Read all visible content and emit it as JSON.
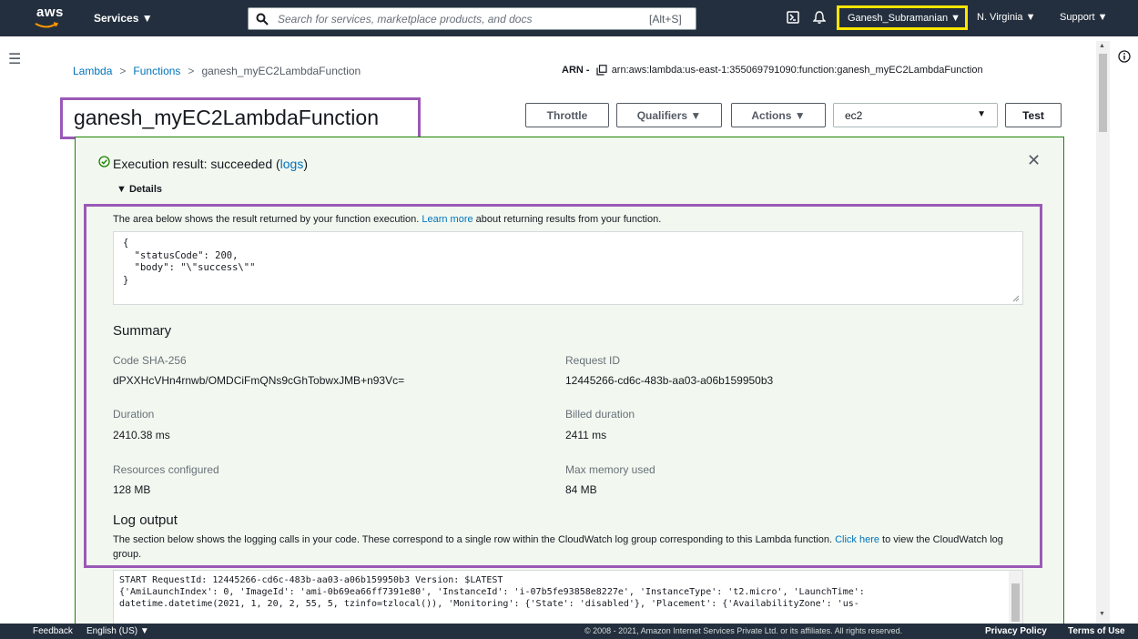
{
  "nav": {
    "logo_text": "aws",
    "services": "Services ▼",
    "search_placeholder": "Search for services, marketplace products, and docs",
    "search_shortcut": "[Alt+S]",
    "user": "Ganesh_Subramanian ▼",
    "region": "N. Virginia ▼",
    "support": "Support ▼"
  },
  "breadcrumb": {
    "items": [
      "Lambda",
      "Functions",
      "ganesh_myEC2LambdaFunction"
    ],
    "separator": ">"
  },
  "arn": {
    "label": "ARN -",
    "value": "arn:aws:lambda:us-east-1:355069791090:function:ganesh_myEC2LambdaFunction"
  },
  "title": "ganesh_myEC2LambdaFunction",
  "toolbar": {
    "throttle": "Throttle",
    "qualifiers": "Qualifiers ▼",
    "actions": "Actions ▼",
    "test_event": "ec2",
    "test": "Test"
  },
  "execution": {
    "title": "Execution result: succeeded (",
    "logs_link": "logs",
    "title_end": ")",
    "details": "▼ Details",
    "intro_before": "The area below shows the result returned by your function execution. ",
    "intro_link": "Learn more",
    "intro_after": " about returning results from your function.",
    "result_json": "{\n  \"statusCode\": 200,\n  \"body\": \"\\\"success\\\"\"\n}"
  },
  "summary": {
    "heading": "Summary",
    "code_sha_label": "Code SHA-256",
    "code_sha_value": "dPXXHcVHn4rnwb/OMDCiFmQNs9cGhTobwxJMB+n93Vc=",
    "request_id_label": "Request ID",
    "request_id_value": "12445266-cd6c-483b-aa03-a06b159950b3",
    "duration_label": "Duration",
    "duration_value": "2410.38 ms",
    "billed_label": "Billed duration",
    "billed_value": "2411 ms",
    "resources_label": "Resources configured",
    "resources_value": "128 MB",
    "memory_label": "Max memory used",
    "memory_value": "84 MB"
  },
  "log": {
    "heading": "Log output",
    "desc_before": "The section below shows the logging calls in your code. These correspond to a single row within the CloudWatch log group corresponding to this Lambda function. ",
    "desc_link": "Click here",
    "desc_after": " to view the CloudWatch log group.",
    "text": "START RequestId: 12445266-cd6c-483b-aa03-a06b159950b3 Version: $LATEST\n{'AmiLaunchIndex': 0, 'ImageId': 'ami-0b69ea66ff7391e80', 'InstanceId': 'i-07b5fe93858e8227e', 'InstanceType': 't2.micro', 'LaunchTime':\ndatetime.datetime(2021, 1, 20, 2, 55, 5, tzinfo=tzlocal()), 'Monitoring': {'State': 'disabled'}, 'Placement': {'AvailabilityZone': 'us-"
  },
  "footer": {
    "feedback": "Feedback",
    "language": "English (US) ▼",
    "copyright": "© 2008 - 2021, Amazon Internet Services Private Ltd. or its affiliates. All rights reserved.",
    "privacy": "Privacy Policy",
    "terms": "Terms of Use"
  },
  "colors": {
    "nav_bg": "#232f3e",
    "link": "#0073bb",
    "success": "#1d8102",
    "annotation": "#9b59b6",
    "highlight": "#ffe600"
  }
}
